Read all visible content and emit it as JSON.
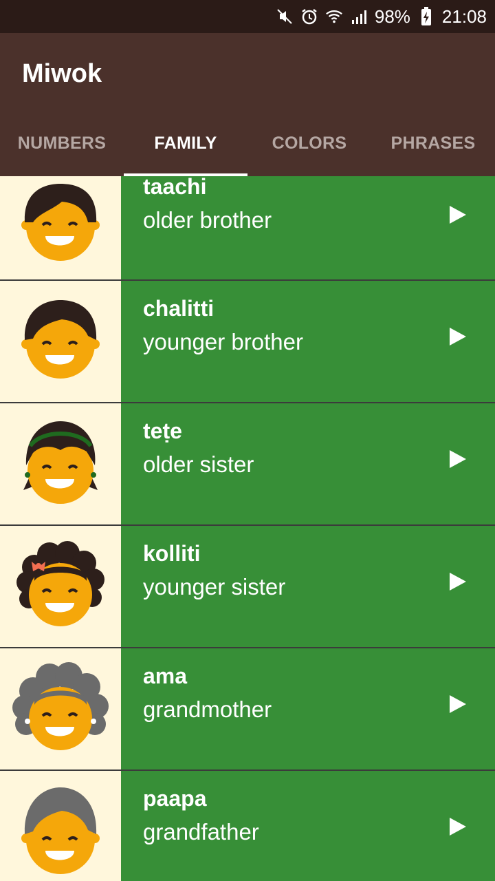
{
  "status_bar": {
    "battery": "98%",
    "time": "21:08",
    "icons": [
      "mute-icon",
      "alarm-icon",
      "wifi-icon",
      "signal-icon",
      "battery-charging-icon"
    ]
  },
  "app": {
    "title": "Miwok"
  },
  "tabs": [
    {
      "label": "NUMBERS",
      "active": false
    },
    {
      "label": "FAMILY",
      "active": true
    },
    {
      "label": "COLORS",
      "active": false
    },
    {
      "label": "PHRASES",
      "active": false
    }
  ],
  "items": [
    {
      "miwok": "taachi",
      "english": "older brother",
      "icon": "older-brother-icon"
    },
    {
      "miwok": "chalitti",
      "english": "younger brother",
      "icon": "younger-brother-icon"
    },
    {
      "miwok": "teṭe",
      "english": "older sister",
      "icon": "older-sister-icon"
    },
    {
      "miwok": "kolliti",
      "english": "younger sister",
      "icon": "younger-sister-icon"
    },
    {
      "miwok": "ama",
      "english": "grandmother",
      "icon": "grandmother-icon"
    },
    {
      "miwok": "paapa",
      "english": "grandfather",
      "icon": "grandfather-icon"
    }
  ],
  "colors": {
    "status_bar": "#2b1b17",
    "app_bar": "#4b312b",
    "item_bg": "#378f37",
    "thumb_bg": "#fff7dc",
    "face": "#f5a70a"
  }
}
